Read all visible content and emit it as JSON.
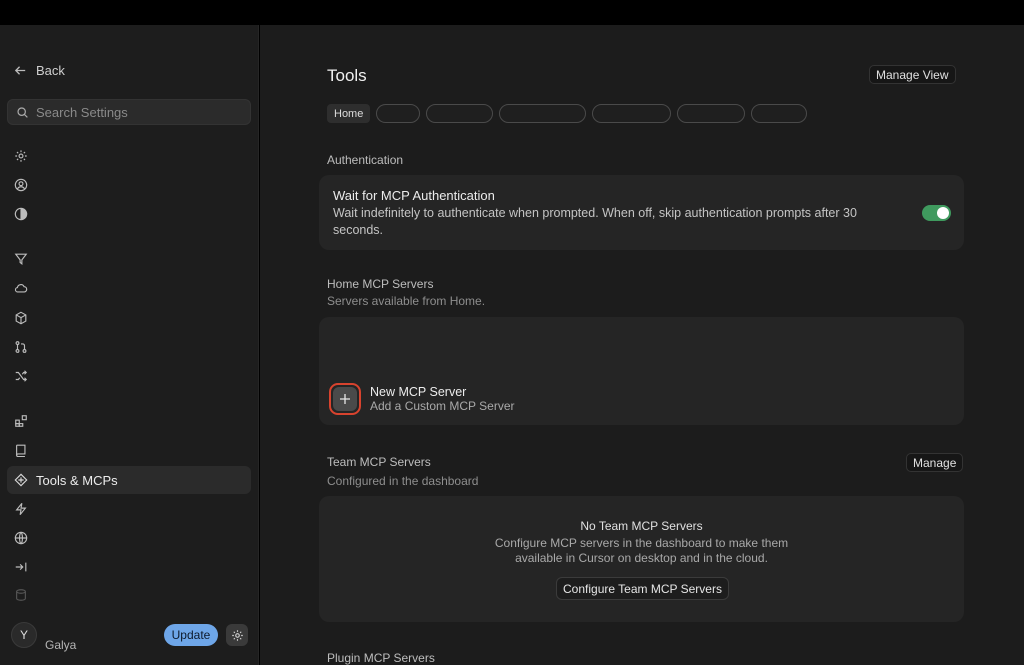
{
  "sidebar": {
    "back_label": "Back",
    "search_placeholder": "Search Settings",
    "active_item_label": "Tools & MCPs",
    "user": {
      "initial": "Y",
      "name": "Galya"
    },
    "update_label": "Update",
    "icons": [
      "gear-icon",
      "user-circle-icon",
      "half-circle-icon",
      "filter-icon",
      "cloud-icon",
      "cube-icon",
      "git-pull-request-icon",
      "shuffle-icon",
      "blocks-icon",
      "book-icon",
      "tools-icon",
      "lightning-icon",
      "globe-icon",
      "arrow-to-line-icon",
      "database-icon"
    ]
  },
  "main": {
    "title": "Tools",
    "manage_view_label": "Manage View",
    "tabs": [
      {
        "label": "Home"
      },
      {
        "label": ""
      },
      {
        "label": ""
      },
      {
        "label": ""
      },
      {
        "label": ""
      },
      {
        "label": ""
      },
      {
        "label": ""
      }
    ],
    "authentication": {
      "heading": "Authentication",
      "title": "Wait for MCP Authentication",
      "description": "Wait indefinitely to authenticate when prompted. When off, skip authentication prompts after 30 seconds.",
      "toggle_on": true
    },
    "home_servers": {
      "heading": "Home MCP Servers",
      "subheading": "Servers available from Home.",
      "new_title": "New MCP Server",
      "new_subtitle": "Add a Custom MCP Server"
    },
    "team_servers": {
      "heading": "Team MCP Servers",
      "subheading": "Configured in the dashboard",
      "manage_label": "Manage",
      "empty_title": "No Team MCP Servers",
      "empty_description": "Configure MCP servers in the dashboard to make them available in Cursor on desktop and in the cloud.",
      "configure_label": "Configure Team MCP Servers"
    },
    "plugin_servers": {
      "heading": "Plugin MCP Servers"
    }
  },
  "colors": {
    "accent_toggle": "#3f9a5e",
    "update_button": "#6ea6e8",
    "highlight_ring": "#d8432e"
  }
}
